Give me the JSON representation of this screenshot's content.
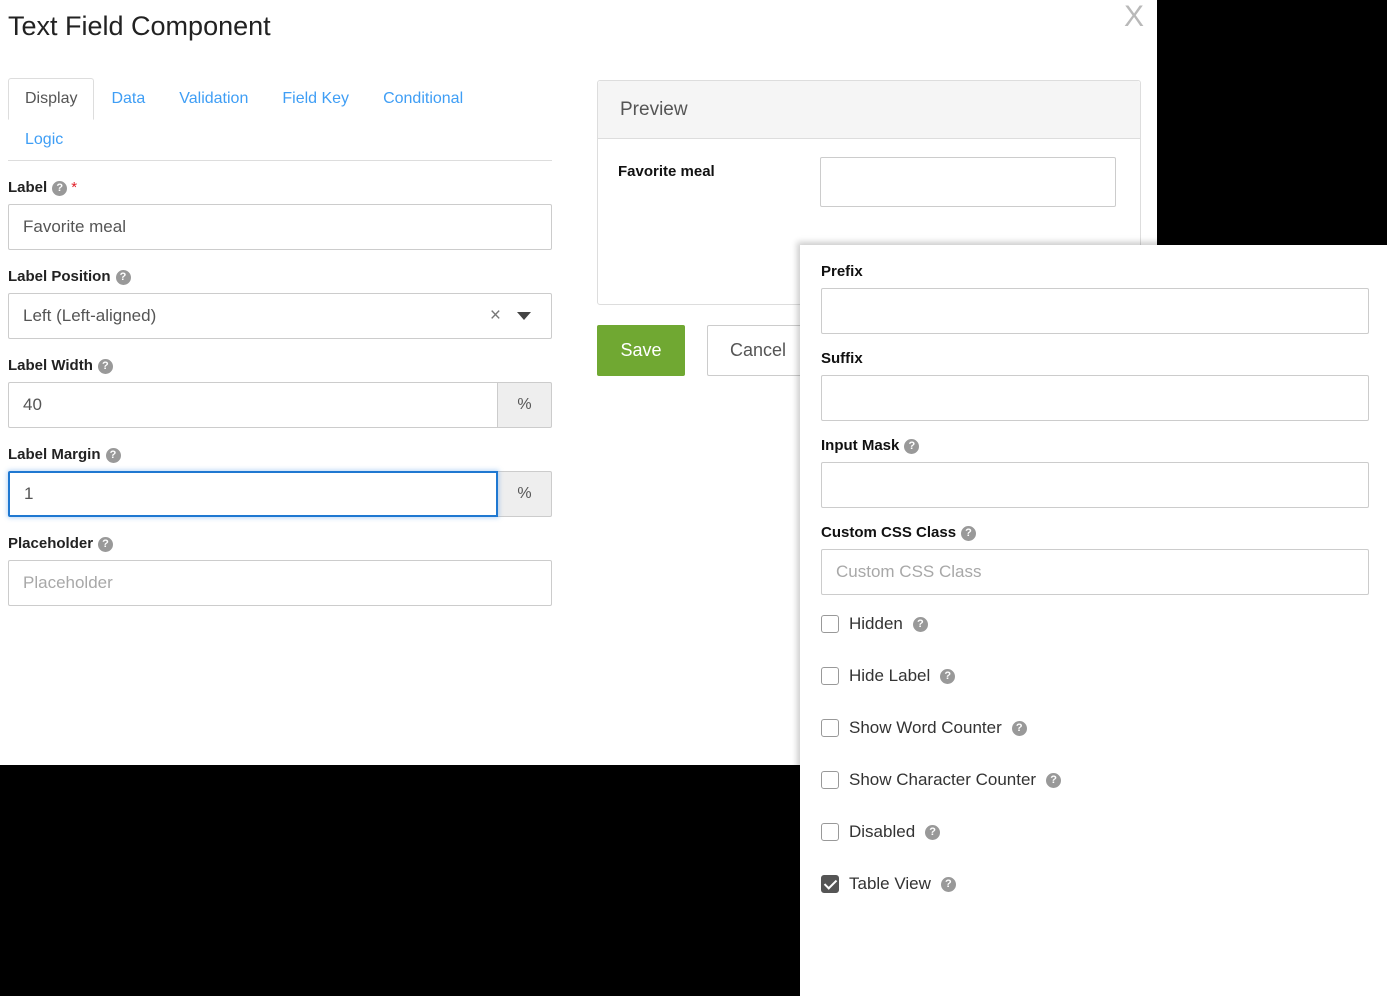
{
  "modal": {
    "title": "Text Field Component",
    "close_label": "X"
  },
  "tabs": [
    {
      "label": "Display",
      "active": true
    },
    {
      "label": "Data",
      "active": false
    },
    {
      "label": "Validation",
      "active": false
    },
    {
      "label": "Field Key",
      "active": false
    },
    {
      "label": "Conditional",
      "active": false
    },
    {
      "label": "Logic",
      "active": false
    }
  ],
  "display_form": {
    "label": {
      "title": "Label",
      "required_marker": "*",
      "help": "?",
      "value": "Favorite meal"
    },
    "label_position": {
      "title": "Label Position",
      "help": "?",
      "value": "Left (Left-aligned)",
      "clear": "×"
    },
    "label_width": {
      "title": "Label Width",
      "help": "?",
      "value": "40",
      "unit": "%"
    },
    "label_margin": {
      "title": "Label Margin",
      "help": "?",
      "value": "1",
      "unit": "%",
      "focused": true
    },
    "placeholder": {
      "title": "Placeholder",
      "help": "?",
      "value": "",
      "placeholder": "Placeholder"
    }
  },
  "preview": {
    "header": "Preview",
    "field_label": "Favorite meal",
    "field_value": ""
  },
  "actions": {
    "save_label": "Save",
    "cancel_label": "Cancel"
  },
  "right_panel": {
    "prefix": {
      "title": "Prefix",
      "value": ""
    },
    "suffix": {
      "title": "Suffix",
      "value": ""
    },
    "input_mask": {
      "title": "Input Mask",
      "help": "?",
      "value": ""
    },
    "custom_css_class": {
      "title": "Custom CSS Class",
      "help": "?",
      "value": "",
      "placeholder": "Custom CSS Class"
    },
    "checkboxes": [
      {
        "label": "Hidden",
        "help": "?",
        "checked": false
      },
      {
        "label": "Hide Label",
        "help": "?",
        "checked": false
      },
      {
        "label": "Show Word Counter",
        "help": "?",
        "checked": false
      },
      {
        "label": "Show Character Counter",
        "help": "?",
        "checked": false
      },
      {
        "label": "Disabled",
        "help": "?",
        "checked": false
      },
      {
        "label": "Table View",
        "help": "?",
        "checked": true
      }
    ]
  },
  "colors": {
    "accent_link": "#3f9ef5",
    "save_green": "#70a832",
    "required_red": "#e11d26",
    "focus_blue": "#1f78d1",
    "help_gray": "#999999"
  }
}
